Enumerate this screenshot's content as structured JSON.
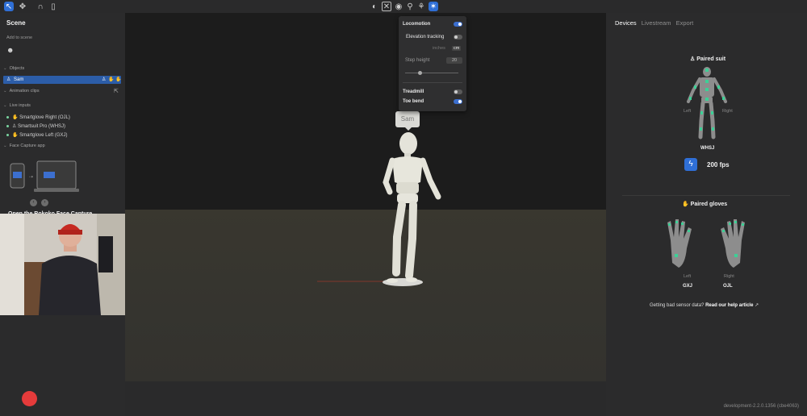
{
  "toolbar": {
    "left_icons": [
      "select-icon",
      "move-icon",
      "headset-icon",
      "phone-icon"
    ],
    "center_icons": [
      "suit-icon",
      "skeleton-icon",
      "eye-icon",
      "walk-icon",
      "locomotion-icon",
      "magic-icon"
    ]
  },
  "scene": {
    "title": "Scene",
    "add_to_scene": "Add to scene",
    "objects_header": "Objects",
    "object_name": "Sam",
    "animation_clips_header": "Animation clips",
    "live_inputs_header": "Live inputs",
    "live_inputs": [
      {
        "label": "Smartglove Right (OJL)",
        "icon": "glove-icon"
      },
      {
        "label": "Smartsuit Pro (WHSJ)",
        "icon": "suit-icon"
      },
      {
        "label": "Smartglove Left (GXJ)",
        "icon": "glove-icon"
      }
    ],
    "face_capture_header": "Face Capture app",
    "pager": [
      "‹",
      "›"
    ],
    "face_cta": "Open the Rokoko Face Capture"
  },
  "locomotion": {
    "title": "Locomotion",
    "title_on": true,
    "elevation_tracking": "Elevation tracking",
    "elevation_on": false,
    "units": [
      "inches",
      "cm"
    ],
    "unit_selected": "cm",
    "step_height_label": "Step height",
    "step_height_value": "20",
    "treadmill": "Treadmill",
    "treadmill_on": false,
    "toe_bend": "Toe bend",
    "toe_bend_on": true
  },
  "character_tag": "Sam",
  "devices": {
    "tabs": [
      "Devices",
      "Livestream",
      "Export"
    ],
    "active_tab": "Devices",
    "paired_suit": "Paired suit",
    "suit_left": "Left",
    "suit_right": "Right",
    "suit_id": "WHSJ",
    "fps": "200 fps",
    "paired_gloves": "Paired gloves",
    "glove_left_label": "Left",
    "glove_right_label": "Right",
    "glove_left_id": "GXJ",
    "glove_right_id": "OJL",
    "help_prefix": "Getting bad sensor data?",
    "help_link": "Read our help article",
    "sensor_color": "#3ecf96"
  },
  "version": "development-2.2.0.1356 (cbe4063)"
}
